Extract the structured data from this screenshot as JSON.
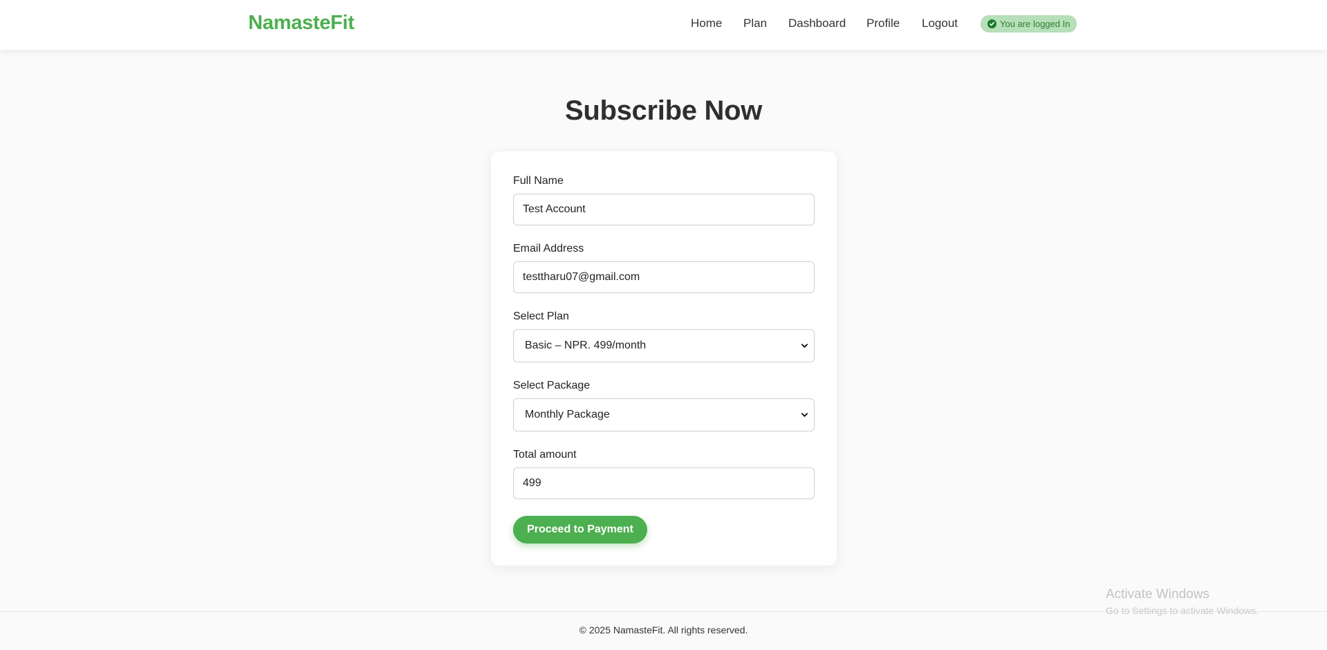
{
  "brand": {
    "name": "NamasteFit",
    "color": "#4caf50"
  },
  "nav": {
    "items": [
      "Home",
      "Plan",
      "Dashboard",
      "Profile",
      "Logout"
    ],
    "status_badge": "You are logged In"
  },
  "page": {
    "title": "Subscribe Now"
  },
  "form": {
    "full_name": {
      "label": "Full Name",
      "value": "Test Account"
    },
    "email": {
      "label": "Email Address",
      "value": "testtharu07@gmail.com"
    },
    "plan": {
      "label": "Select Plan",
      "selected": "Basic – NPR. 499/month"
    },
    "package": {
      "label": "Select Package",
      "selected": "Monthly Package"
    },
    "total": {
      "label": "Total amount",
      "value": "499"
    },
    "submit_label": "Proceed to Payment"
  },
  "footer": {
    "text": "© 2025 NamasteFit. All rights reserved."
  },
  "watermark": {
    "title": "Activate Windows",
    "subtitle": "Go to Settings to activate Windows."
  },
  "icons": {
    "badge": "check-circle-icon",
    "select_caret": "chevron-down-icon"
  }
}
